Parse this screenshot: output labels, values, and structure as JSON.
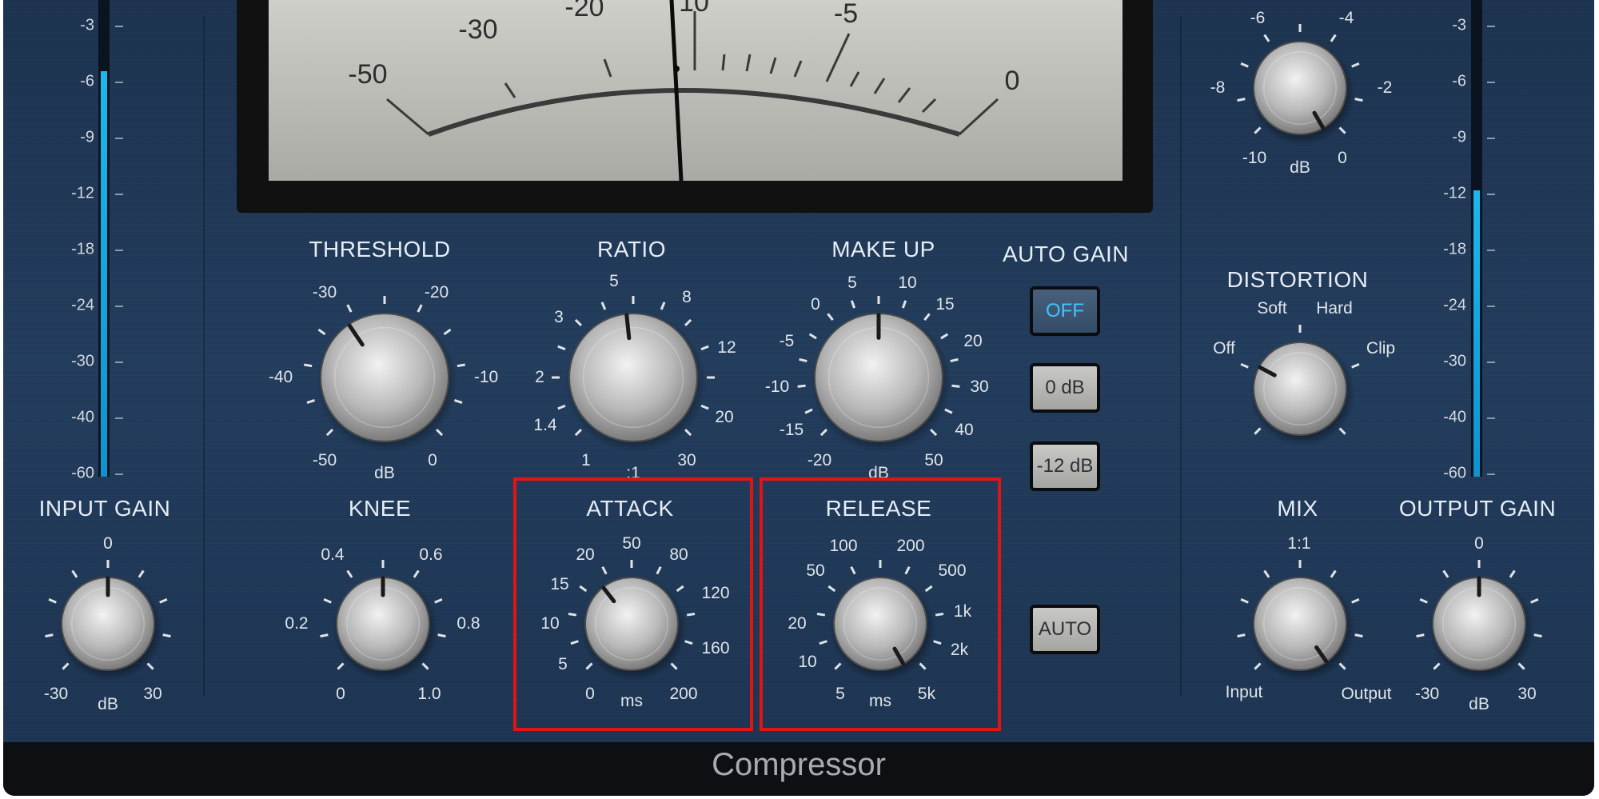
{
  "plugin_title": "Compressor",
  "vu_meter": {
    "scale_labels": [
      "-50",
      "-30",
      "-20",
      "10",
      "-5",
      "0"
    ]
  },
  "input_meter": {
    "scale": [
      "-3",
      "-6",
      "-9",
      "-12",
      "-18",
      "-24",
      "-30",
      "-40",
      "-60"
    ],
    "level_fraction": 0.85
  },
  "output_meter": {
    "scale": [
      "-3",
      "-6",
      "-9",
      "-12",
      "-18",
      "-24",
      "-30",
      "-40",
      "-60"
    ],
    "level_fraction": 0.6
  },
  "controls": {
    "threshold": {
      "label": "THRESHOLD",
      "ticks": [
        "-30",
        "-20",
        "-40",
        "-10",
        "-50",
        "0"
      ],
      "unit": "dB"
    },
    "ratio": {
      "label": "RATIO",
      "ticks": [
        "5",
        "8",
        "3",
        "12",
        "2",
        "20",
        "1.4",
        "30",
        "1"
      ],
      "unit": ":1"
    },
    "make_up": {
      "label": "MAKE UP",
      "ticks": [
        "0",
        "5",
        "10",
        "15",
        "-5",
        "20",
        "-10",
        "30",
        "-15",
        "40",
        "-20",
        "50"
      ],
      "unit": "dB"
    },
    "input_gain": {
      "label": "INPUT GAIN",
      "ticks": [
        "0",
        "-30",
        "30"
      ],
      "unit": "dB"
    },
    "knee": {
      "label": "KNEE",
      "ticks": [
        "0.4",
        "0.6",
        "0.2",
        "0.8",
        "0",
        "1.0"
      ]
    },
    "attack": {
      "label": "ATTACK",
      "ticks": [
        "50",
        "20",
        "80",
        "15",
        "120",
        "10",
        "160",
        "5",
        "0",
        "200"
      ],
      "unit": "ms"
    },
    "release": {
      "label": "RELEASE",
      "ticks": [
        "100",
        "200",
        "50",
        "500",
        "1k",
        "20",
        "2k",
        "10",
        "5",
        "5k"
      ],
      "unit": "ms"
    },
    "top_knob": {
      "ticks": [
        "-6",
        "-4",
        "-8",
        "-2",
        "-10",
        "0"
      ],
      "unit": "dB"
    },
    "distortion": {
      "label": "DISTORTION",
      "ticks": [
        "Soft",
        "Hard",
        "Off",
        "Clip"
      ]
    },
    "mix": {
      "label": "MIX",
      "ticks": [
        "1:1",
        "Input",
        "Output"
      ]
    },
    "output_gain": {
      "label": "OUTPUT GAIN",
      "ticks": [
        "0",
        "-30",
        "30"
      ],
      "unit": "dB"
    }
  },
  "auto_gain": {
    "label": "AUTO GAIN",
    "buttons": [
      "OFF",
      "0 dB",
      "-12 dB"
    ]
  },
  "auto_button": "AUTO",
  "colors": {
    "panel": "#223c5c",
    "meter_fill": "#14a9e6",
    "highlight": "#e01414",
    "active_text": "#3ec6ff"
  }
}
